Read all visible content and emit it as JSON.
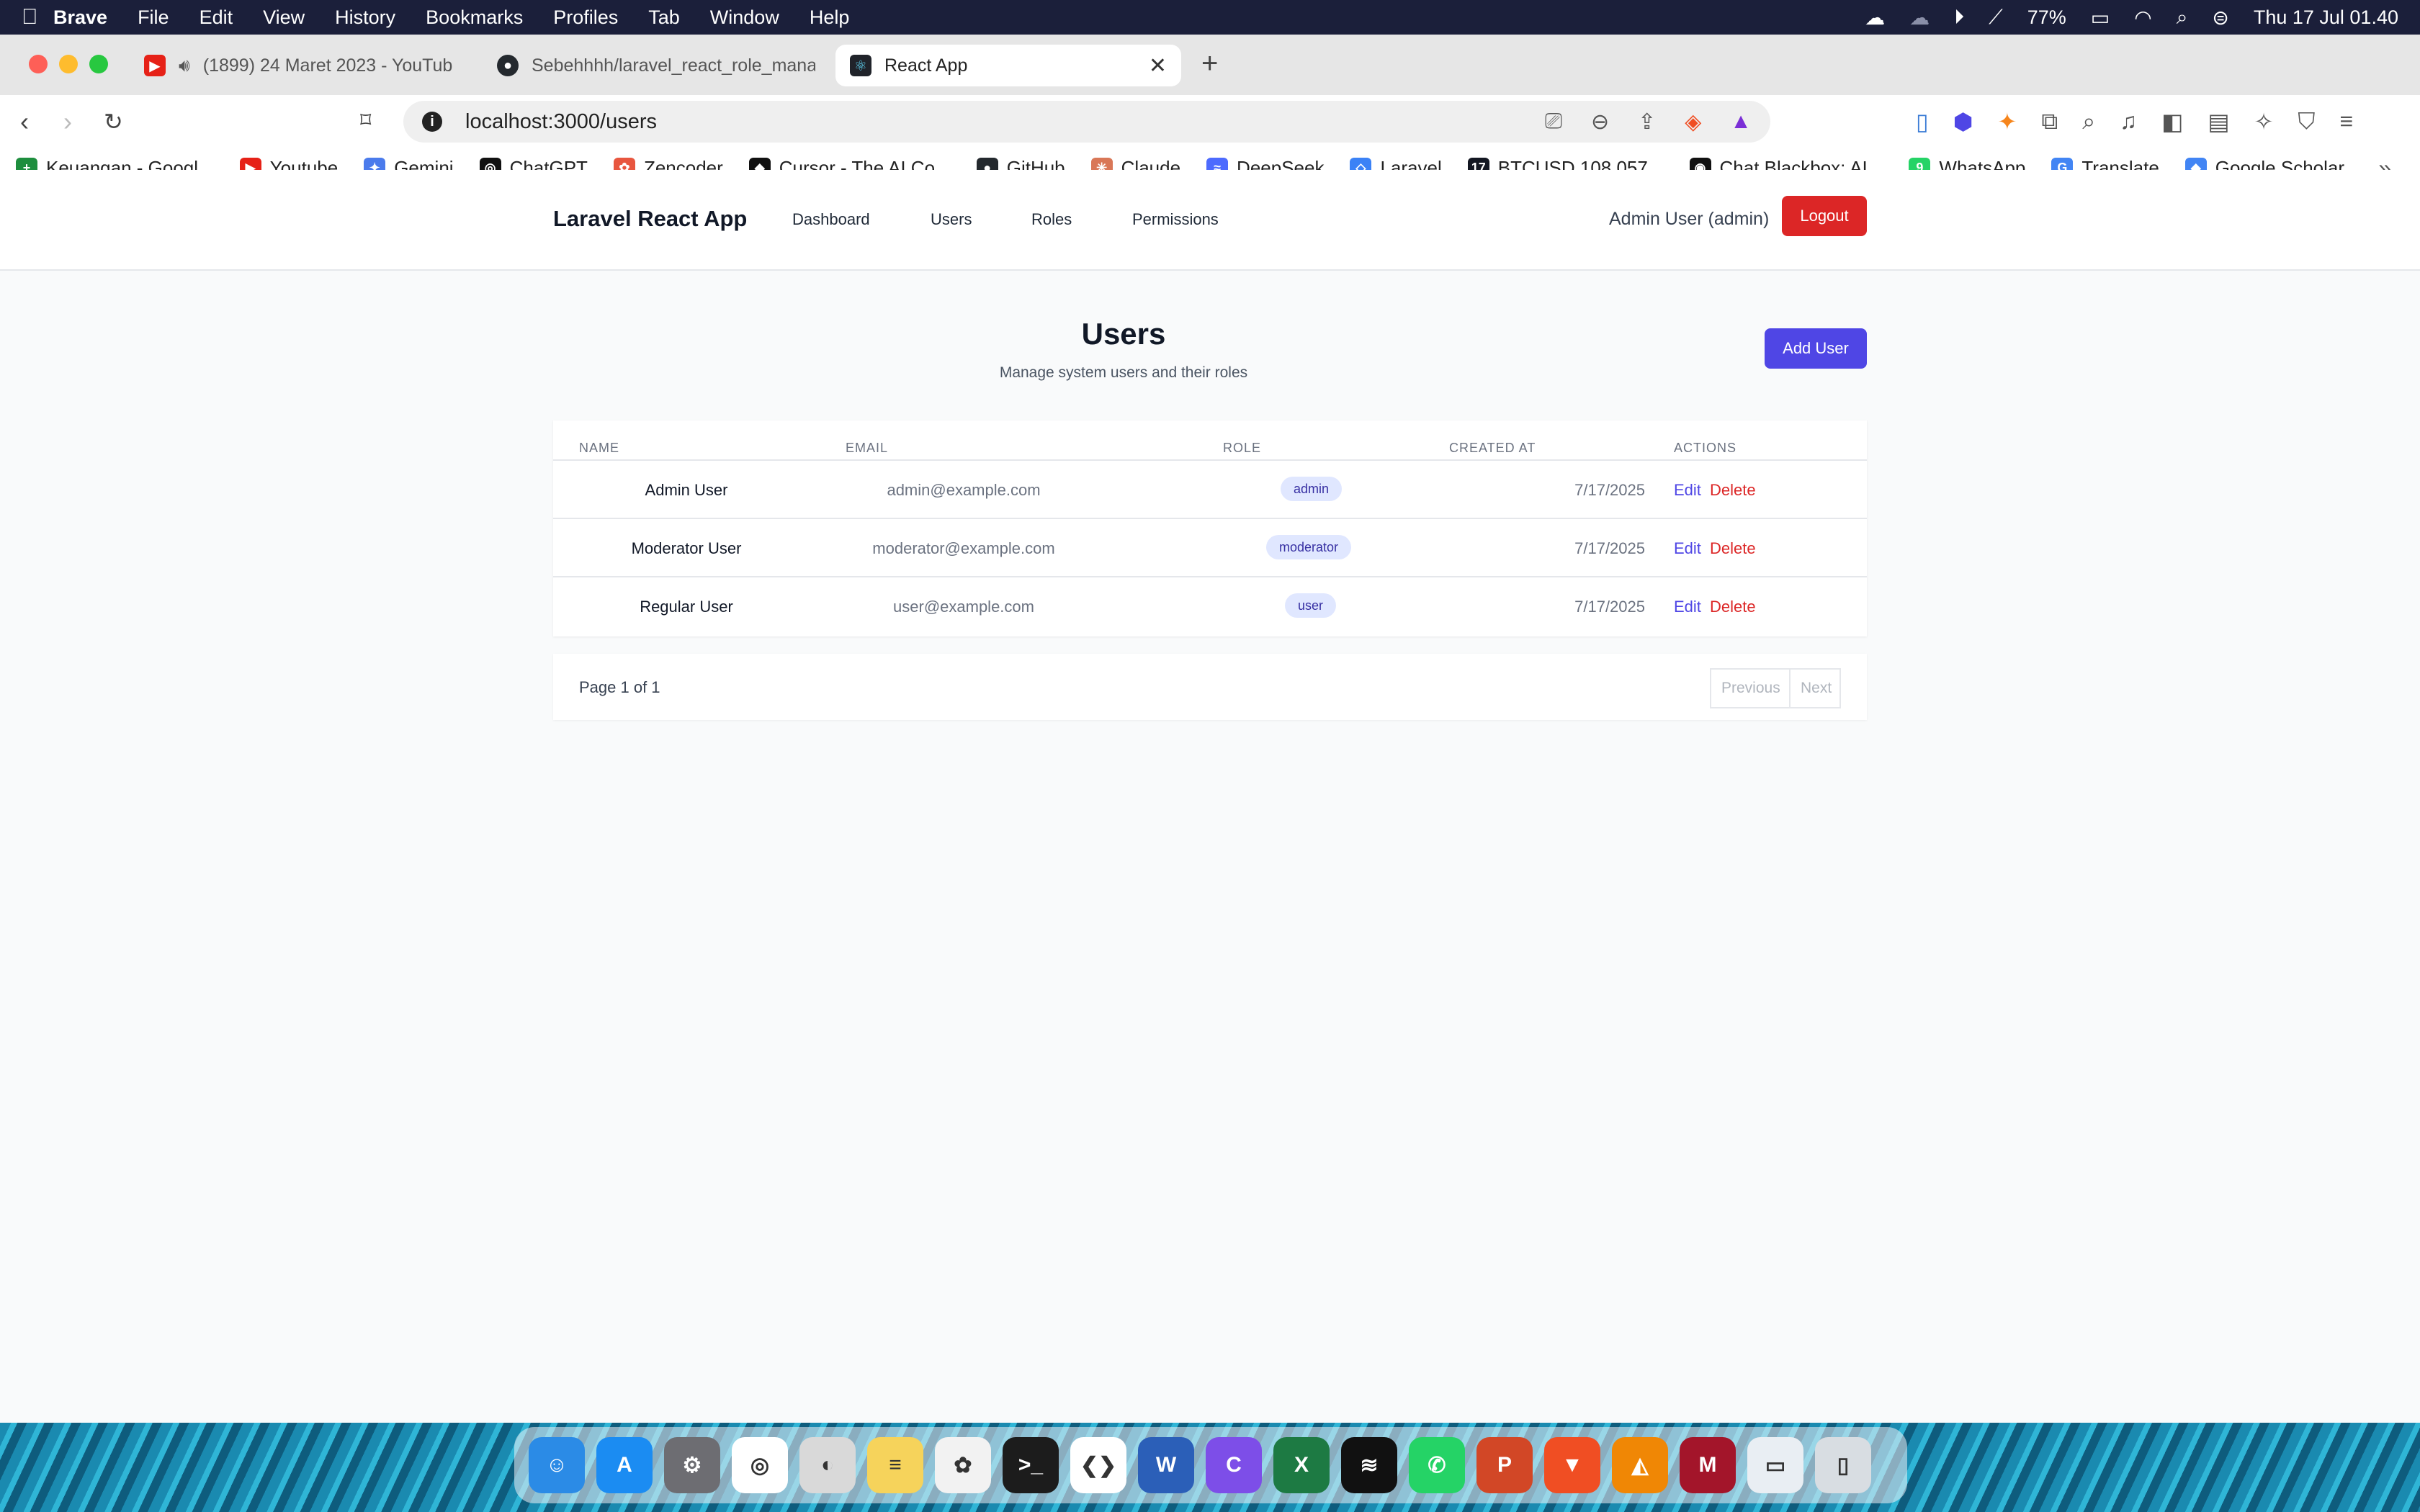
{
  "menubar": {
    "app": "Brave",
    "items": [
      "File",
      "Edit",
      "View",
      "History",
      "Bookmarks",
      "Profiles",
      "Tab",
      "Window",
      "Help"
    ],
    "battery": "77%",
    "clock": "Thu 17 Jul  01.40"
  },
  "tabs": [
    {
      "title": "(1899) 24 Maret 2023 - YouTub",
      "icon": "youtube-icon"
    },
    {
      "title": "Sebehhhh/laravel_react_role_mana",
      "icon": "github-icon"
    },
    {
      "title": "React App",
      "icon": "react-icon",
      "active": true
    }
  ],
  "url": "localhost:3000/users",
  "bookmarks": [
    {
      "label": "Keuangan - Googl...",
      "color": "#1e8e3e",
      "glyph": "+"
    },
    {
      "label": "Youtube",
      "color": "#e62117",
      "glyph": "▶"
    },
    {
      "label": "Gemini",
      "color": "#4b7bec",
      "glyph": "✦"
    },
    {
      "label": "ChatGPT",
      "color": "#111111",
      "glyph": "◎"
    },
    {
      "label": "Zencoder",
      "color": "#e8563f",
      "glyph": "✿"
    },
    {
      "label": "Cursor - The AI Co...",
      "color": "#111111",
      "glyph": "◆"
    },
    {
      "label": "GitHub",
      "color": "#24292e",
      "glyph": "●"
    },
    {
      "label": "Claude",
      "color": "#d97757",
      "glyph": "✳"
    },
    {
      "label": "DeepSeek",
      "color": "#4d6bfe",
      "glyph": "≈"
    },
    {
      "label": "Laravel",
      "color": "#3b82f6",
      "glyph": "◇"
    },
    {
      "label": "BTCUSD 108.057...",
      "color": "#131722",
      "glyph": "17"
    },
    {
      "label": "Chat Blackbox: AI...",
      "color": "#111111",
      "glyph": "◉"
    },
    {
      "label": "WhatsApp",
      "color": "#25d366",
      "glyph": "9"
    },
    {
      "label": "Translate",
      "color": "#4285f4",
      "glyph": "G"
    },
    {
      "label": "Google Scholar",
      "color": "#4285f4",
      "glyph": "◆"
    }
  ],
  "app": {
    "brand": "Laravel React App",
    "nav": [
      "Dashboard",
      "Users",
      "Roles",
      "Permissions"
    ],
    "user": "Admin User (admin)",
    "logout": "Logout"
  },
  "page": {
    "title": "Users",
    "subtitle": "Manage system users and their roles",
    "add_button": "Add User"
  },
  "table": {
    "headers": [
      "NAME",
      "EMAIL",
      "ROLE",
      "CREATED AT",
      "ACTIONS"
    ],
    "rows": [
      {
        "name": "Admin User",
        "email": "admin@example.com",
        "role": "admin",
        "created": "7/17/2025"
      },
      {
        "name": "Moderator User",
        "email": "moderator@example.com",
        "role": "moderator",
        "created": "7/17/2025"
      },
      {
        "name": "Regular User",
        "email": "user@example.com",
        "role": "user",
        "created": "7/17/2025"
      }
    ],
    "edit_label": "Edit",
    "delete_label": "Delete"
  },
  "pagination": {
    "info": "Page 1 of 1",
    "previous": "Previous",
    "next": "Next"
  },
  "dock": [
    {
      "name": "finder-icon",
      "color": "#2b8be6",
      "glyph": "☺"
    },
    {
      "name": "app-store-icon",
      "color": "#1b8cf2",
      "glyph": "A"
    },
    {
      "name": "system-settings-icon",
      "color": "#6d6d72",
      "glyph": "⚙"
    },
    {
      "name": "chatgpt-icon",
      "color": "#ffffff",
      "glyph": "◎"
    },
    {
      "name": "sequel-ace-icon",
      "color": "#d9d9d9",
      "glyph": "◐"
    },
    {
      "name": "notes-icon",
      "color": "#f6d35b",
      "glyph": "≡"
    },
    {
      "name": "photos-icon",
      "color": "#f2f2f2",
      "glyph": "✿"
    },
    {
      "name": "terminal-icon",
      "color": "#1c1c1c",
      "glyph": ">_"
    },
    {
      "name": "vscode-icon",
      "color": "#ffffff",
      "glyph": "❮❯"
    },
    {
      "name": "word-icon",
      "color": "#2b5fb8",
      "glyph": "W"
    },
    {
      "name": "canva-icon",
      "color": "#7d4ee8",
      "glyph": "C"
    },
    {
      "name": "excel-icon",
      "color": "#1d7a43",
      "glyph": "X"
    },
    {
      "name": "spotify-icon",
      "color": "#111111",
      "glyph": "≋"
    },
    {
      "name": "whatsapp-icon",
      "color": "#25d366",
      "glyph": "✆"
    },
    {
      "name": "powerpoint-icon",
      "color": "#d24726",
      "glyph": "P"
    },
    {
      "name": "brave-icon",
      "color": "#f04e23",
      "glyph": "▼"
    },
    {
      "name": "draw-io-icon",
      "color": "#f08705",
      "glyph": "◭"
    },
    {
      "name": "mendeley-icon",
      "color": "#a3152a",
      "glyph": "M"
    },
    {
      "name": "screenshot-thumbnail-icon",
      "color": "#e9eef3",
      "glyph": "▭"
    },
    {
      "name": "trash-icon",
      "color": "#d8dde2",
      "glyph": "▯"
    }
  ]
}
